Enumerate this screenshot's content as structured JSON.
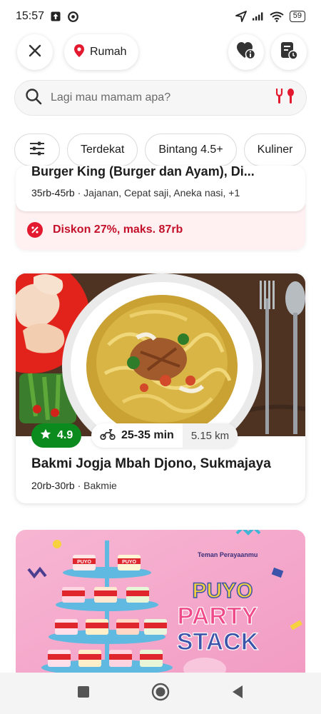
{
  "status": {
    "time": "15:57",
    "battery": "59"
  },
  "header": {
    "location_label": "Rumah"
  },
  "search": {
    "placeholder": "Lagi mau mamam apa?"
  },
  "filters": [
    {
      "label": "Terdekat"
    },
    {
      "label": "Bintang 4.5+"
    },
    {
      "label": "Kuliner"
    }
  ],
  "restaurants": [
    {
      "name_cut": "Burger King (Burger dan Ayam), Di...",
      "price_range": "35rb-45rb",
      "categories": "Jajanan, Cepat saji, Aneka nasi, +1",
      "promo": "Diskon 27%, maks. 87rb"
    },
    {
      "name": "Bakmi Jogja Mbah Djono, Sukmajaya",
      "rating": "4.9",
      "eta": "25-35 min",
      "distance": "5.15 km",
      "price_range": "20rb-30rb",
      "categories": "Bakmie"
    }
  ],
  "banner": {
    "brand": "Teman Perayaanmu",
    "line1": "PUYO",
    "line2": "PARTY",
    "line3": "STACK",
    "cup_label": "PUYO"
  },
  "colors": {
    "brand_red": "#e3192f",
    "rating_green": "#0b8a1d",
    "banner_pink": "#f7a9cd"
  }
}
